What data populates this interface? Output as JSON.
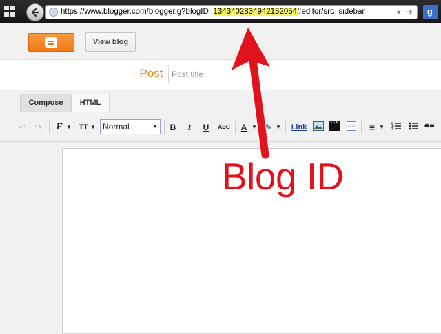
{
  "browser": {
    "url_prefix": "https://www.blogger.com/blogger.g?blogID=",
    "url_highlight": "1343402834942152054",
    "url_suffix": "#editor/src=sidebar",
    "search_engine_letter": "g"
  },
  "header": {
    "view_blog_label": "View blog"
  },
  "post": {
    "label": "· Post",
    "title_placeholder": "Post title",
    "title_value": ""
  },
  "mode_tabs": [
    {
      "label": "Compose",
      "active": true
    },
    {
      "label": "HTML",
      "active": false
    }
  ],
  "toolbar": {
    "font_value": "Normal",
    "bold": "B",
    "italic": "I",
    "underline": "U",
    "strikethrough": "ABC",
    "text_color": "A",
    "font_family": "F",
    "font_size": "TT",
    "link": "Link",
    "quote": "❝❝"
  },
  "annotation": {
    "text": "Blog ID",
    "color": "#e0121b"
  },
  "colors": {
    "brand_orange": "#f07b16",
    "highlight": "#f7f36a"
  }
}
